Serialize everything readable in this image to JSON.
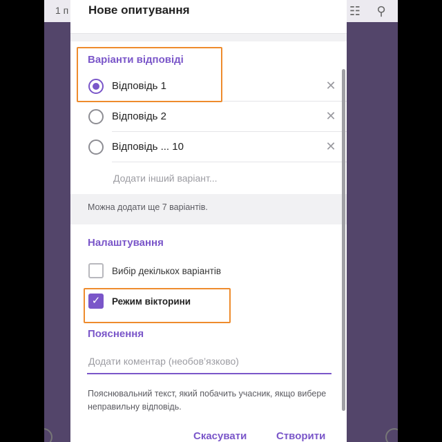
{
  "background_app": {
    "subtitle": "1 п",
    "icons": [
      "poll-icon",
      "search-icon"
    ]
  },
  "dialog": {
    "title": "Нове опитування",
    "answers_section_title": "Варіанти відповіді",
    "options": [
      {
        "label": "Відповідь 1",
        "selected": true
      },
      {
        "label": "Відповідь 2",
        "selected": false
      },
      {
        "label": "Відповідь ... 10",
        "selected": false
      }
    ],
    "add_option_placeholder": "Додати інший варіант...",
    "remaining_hint": "Можна додати ще 7 варіантів.",
    "settings_section_title": "Налаштування",
    "settings": [
      {
        "label": "Вибір декількох варіантів",
        "checked": false
      },
      {
        "label": "Режим вікторини",
        "checked": true
      }
    ],
    "explanation_section_title": "Пояснення",
    "comment_placeholder": "Додати коментар (необов’язково)",
    "explanation_hint": "Пояснювальний текст, який побачить учасник, якщо вибере неправильну відповідь.",
    "cancel_label": "Скасувати",
    "create_label": "Створити"
  },
  "colors": {
    "accent": "#7a56c9",
    "highlight": "#ee8b2c",
    "chat_background": "#53456a"
  }
}
